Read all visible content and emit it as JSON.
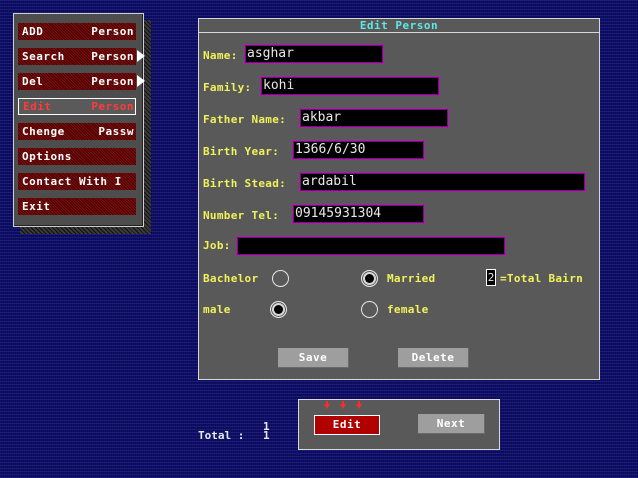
{
  "menu": {
    "items": [
      {
        "w1": "ADD",
        "w2": "Person"
      },
      {
        "w1": "Search",
        "w2": "Person"
      },
      {
        "w1": "Del",
        "w2": "Person"
      },
      {
        "w1": "Edit",
        "w2": "Person"
      },
      {
        "w1": "Chenge",
        "w2": "Passw"
      },
      {
        "w1": "Options",
        "w2": ""
      },
      {
        "w1": "Contact With I",
        "w2": ""
      },
      {
        "w1": "Exit",
        "w2": ""
      }
    ],
    "active_index": 3
  },
  "form": {
    "title": "Edit Person",
    "name_label": "Name:",
    "name_value": "asghar",
    "family_label": "Family:",
    "family_value": "kohi",
    "father_label": "Father Name:",
    "father_value": "akbar",
    "birth_year_label": "Birth Year:",
    "birth_year_value": "1366/6/30",
    "birth_stead_label": "Birth Stead:",
    "birth_stead_value": "ardabil",
    "tel_label": "Number Tel:",
    "tel_value": "09145931304",
    "job_label": "Job:",
    "job_value": "",
    "bachelor_label": "Bachelor",
    "married_label": "Married",
    "bairn_value": "2",
    "total_bairn_label": "=Total Bairn",
    "male_label": "male",
    "female_label": "female",
    "marital_selected": "Married",
    "gender_selected": "male",
    "save_label": "Save",
    "delete_label": "Delete"
  },
  "footer": {
    "total_label": "Total :",
    "current_count": "1",
    "total_count": "1",
    "edit_label": "Edit",
    "next_label": "Next"
  }
}
